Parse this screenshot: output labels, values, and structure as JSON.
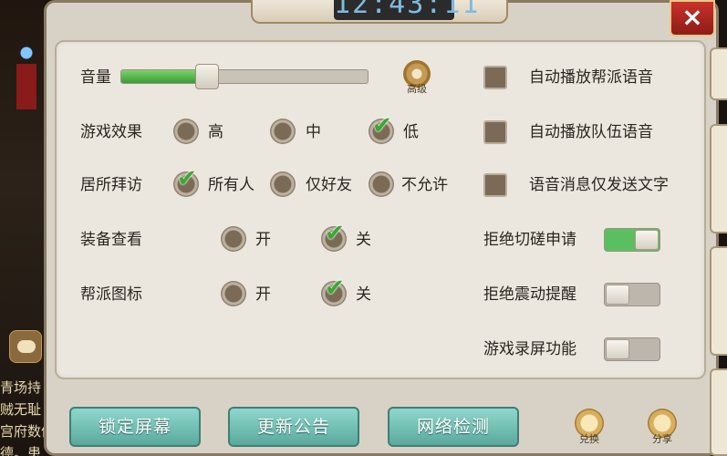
{
  "timer": "12:43:11",
  "close_label": "×",
  "left_sidebar": {
    "lines": [
      "青场持",
      "贼无耻",
      "宫府数值",
      "德。患"
    ]
  },
  "settings": {
    "volume": {
      "label": "音量",
      "level": 0.35
    },
    "advanced": {
      "label": "高级"
    },
    "game_effect": {
      "label": "游戏效果",
      "options": [
        "高",
        "中",
        "低"
      ],
      "selected": "低"
    },
    "home_visit": {
      "label": "居所拜访",
      "options": [
        "所有人",
        "仅好友",
        "不允许"
      ],
      "selected": "所有人"
    },
    "equip_view": {
      "label": "装备查看",
      "options": [
        "开",
        "关"
      ],
      "selected": "关"
    },
    "guild_icon": {
      "label": "帮派图标",
      "options": [
        "开",
        "关"
      ],
      "selected": "关"
    },
    "auto_guild_voice": {
      "label": "自动播放帮派语音",
      "checked": false
    },
    "auto_team_voice": {
      "label": "自动播放队伍语音",
      "checked": false
    },
    "voice_text_only": {
      "label": "语音消息仅发送文字",
      "checked": false
    },
    "reject_duel": {
      "label": "拒绝切磋申请",
      "on": true
    },
    "reject_vibrate": {
      "label": "拒绝震动提醒",
      "on": false
    },
    "screen_record": {
      "label": "游戏录屏功能",
      "on": false
    }
  },
  "buttons": {
    "lock_screen": "锁定屏幕",
    "update_notice": "更新公告",
    "network_check": "网络检测",
    "redeem": "兑换",
    "share": "分享"
  }
}
